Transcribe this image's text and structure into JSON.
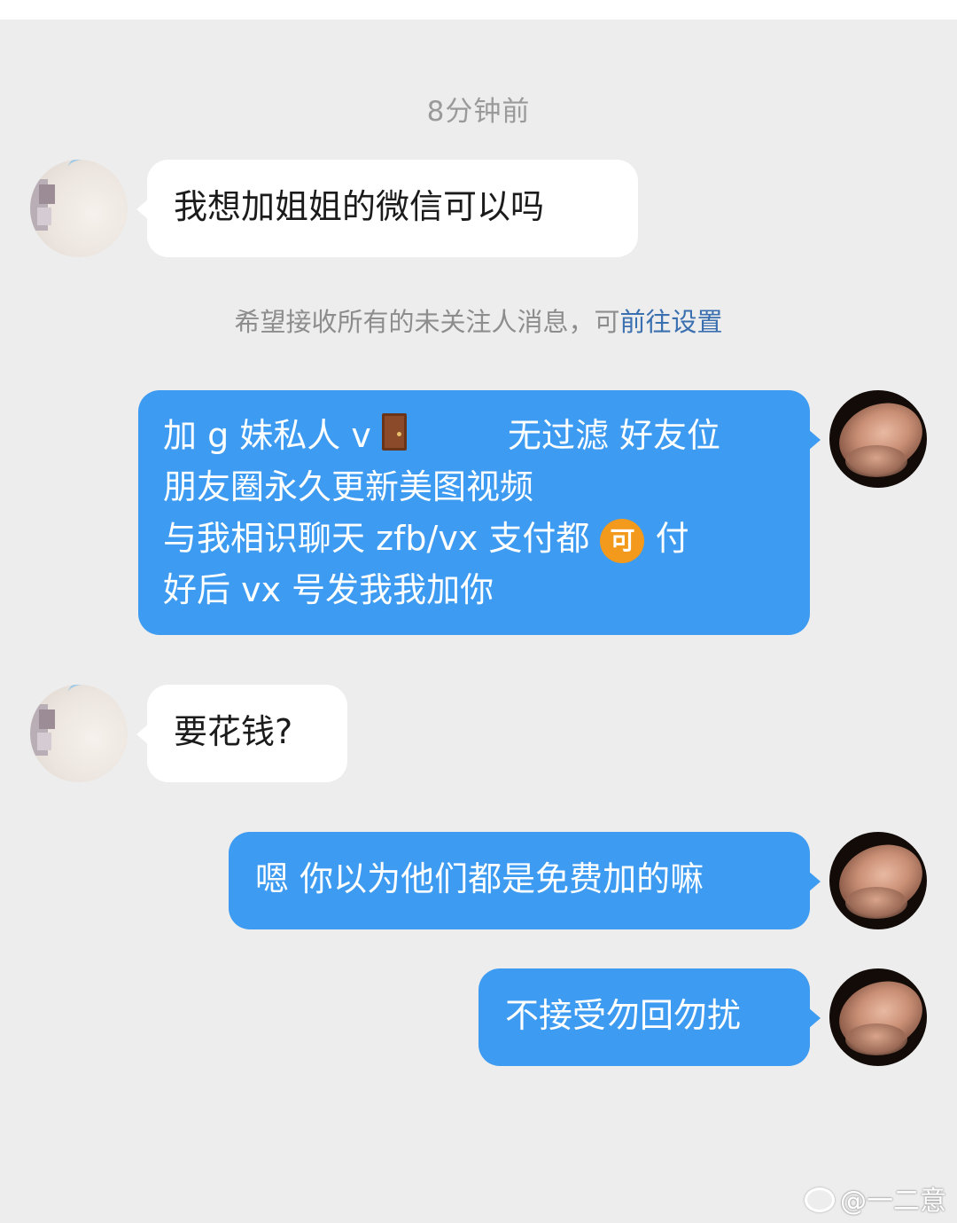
{
  "timestamp": "8分钟前",
  "notice": {
    "text": "希望接收所有的未关注人消息，可",
    "link": "前往设置"
  },
  "messages": [
    {
      "side": "left",
      "text": "我想加姐姐的微信可以吗"
    },
    {
      "side": "right",
      "lines": [
        "加 g 妹私人 v",
        "无过滤 好友位",
        "朋友圈永久更新美图视频",
        "与我相识聊天  zfb/vx 支付都",
        "付",
        "好后 vx 号发我我加你"
      ],
      "badge": "可"
    },
    {
      "side": "left",
      "text": "要花钱?"
    },
    {
      "side": "right",
      "text": "嗯 你以为他们都是免费加的嘛"
    },
    {
      "side": "right",
      "text": "不接受勿回勿扰"
    }
  ],
  "icons": {
    "door": "door-icon",
    "weibo": "weibo-icon"
  },
  "colors": {
    "background": "#ededed",
    "bubble_out": "#3d9bf2",
    "bubble_in": "#ffffff",
    "link": "#3a6fb0",
    "badge": "#f39a1c"
  },
  "watermark": "@一二意"
}
